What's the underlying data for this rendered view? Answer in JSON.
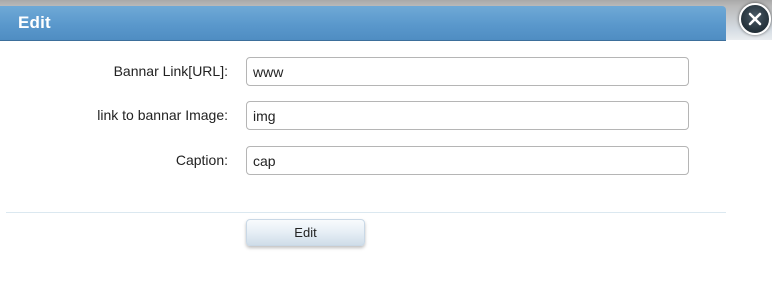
{
  "dialog": {
    "title": "Edit",
    "close_icon": "close-icon"
  },
  "form": {
    "fields": [
      {
        "label": "Bannar Link[URL]:",
        "value": "www"
      },
      {
        "label": "link to bannar Image:",
        "value": "img"
      },
      {
        "label": "Caption:",
        "value": "cap"
      }
    ],
    "submit_label": "Edit"
  },
  "colors": {
    "titlebar": "#5a98cc",
    "title_text": "#ffffff",
    "close_button": "#233039",
    "divider": "#dbe8f0"
  }
}
